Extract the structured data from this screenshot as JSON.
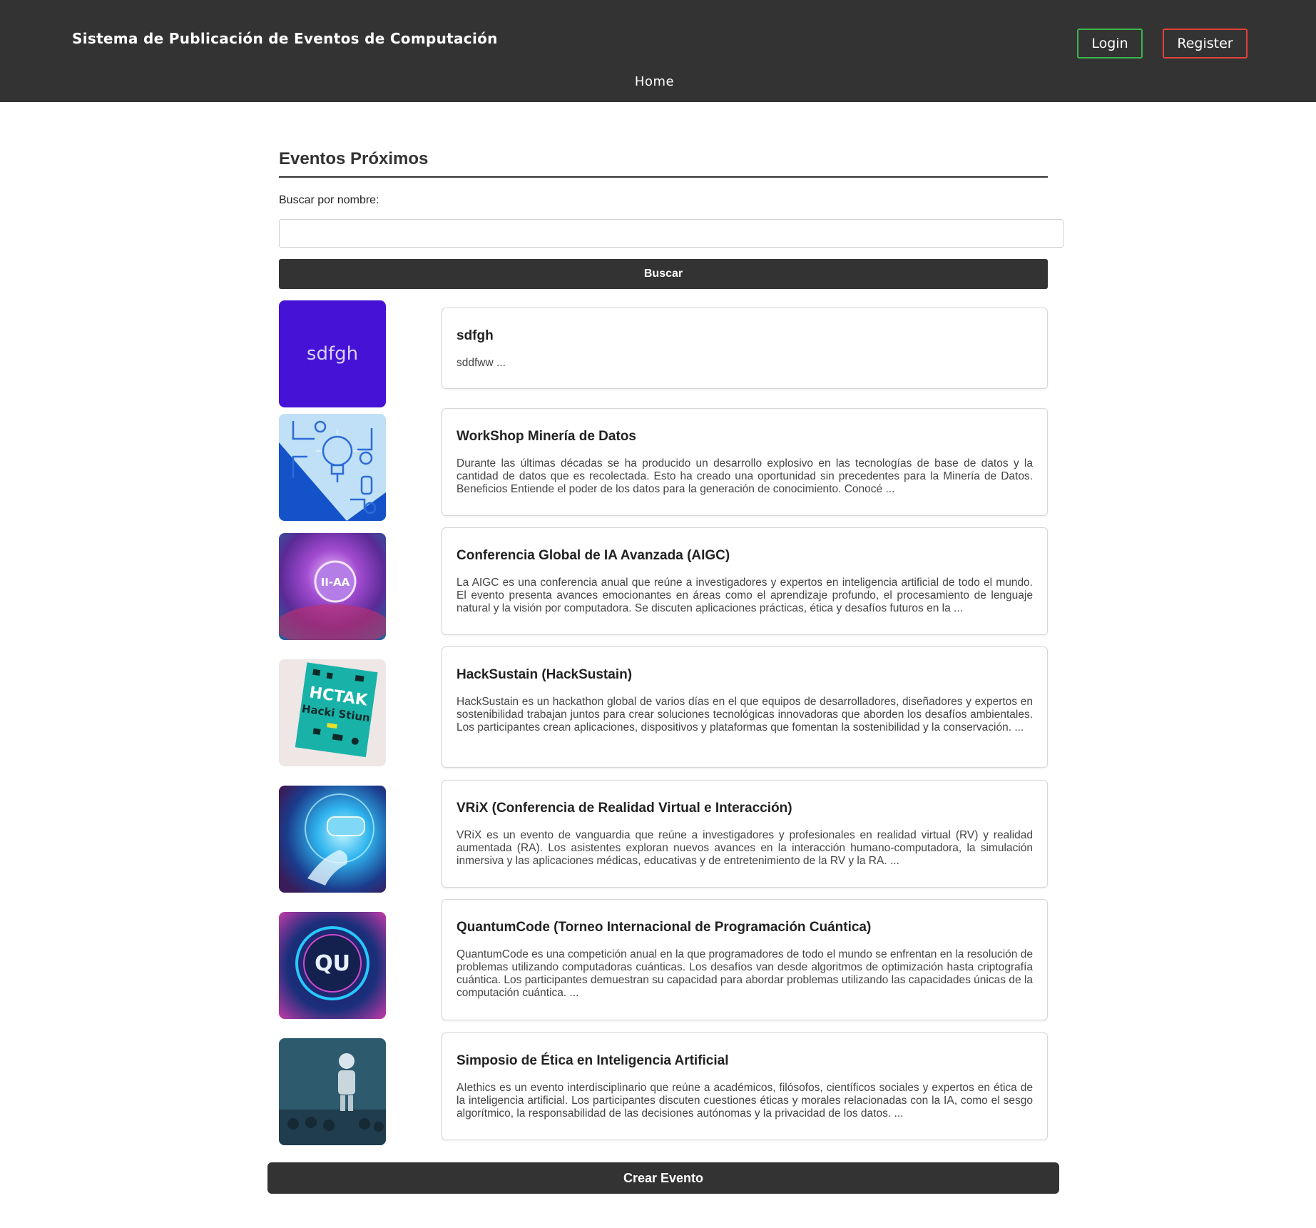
{
  "header": {
    "brand": "Sistema de Publicación de Eventos de Computación",
    "login_label": "Login",
    "register_label": "Register",
    "nav_home": "Home",
    "login_color": "#3bb54a",
    "register_color": "#e2423b",
    "background": "#333333"
  },
  "main": {
    "section_title": "Eventos Próximos",
    "search_label": "Buscar por nombre:",
    "search_value": "",
    "search_button": "Buscar",
    "create_button": "Crear Evento"
  },
  "events": [
    {
      "title": "sdfgh",
      "description": "sddfww ...",
      "image_text": "sdfgh"
    },
    {
      "title": "WorkShop Minería de Datos",
      "description": "Durante las últimas décadas se ha producido un desarrollo explosivo en las tecnologías de base de datos y la cantidad de datos que es recolectada. Esto ha creado una oportunidad sin precedentes para la Minería de Datos. Beneficios Entiende el poder de los datos para la generación de conocimiento. Conocé ..."
    },
    {
      "title": "Conferencia Global de IA Avanzada (AIGC)",
      "description": "La AIGC es una conferencia anual que reúne a investigadores y expertos en inteligencia artificial de todo el mundo. El evento presenta avances emocionantes en áreas como el aprendizaje profundo, el procesamiento de lenguaje natural y la visión por computadora. Se discuten aplicaciones prácticas, ética y desafíos futuros en la ...",
      "image_text": "II-AA"
    },
    {
      "title": "HackSustain (HackSustain)",
      "description": "HackSustain es un hackathon global de varios días en el que equipos de desarrolladores, diseñadores y expertos en sostenibilidad trabajan juntos para crear soluciones tecnológicas innovadoras que aborden los desafíos ambientales. Los participantes crean aplicaciones, dispositivos y plataformas que fomentan la sostenibilidad y la conservación. ...",
      "image_text": "HCTAK",
      "image_subtext": "Hacki Stiun"
    },
    {
      "title": "VRiX (Conferencia de Realidad Virtual e Interacción)",
      "description": "VRiX es un evento de vanguardia que reúne a investigadores y profesionales en realidad virtual (RV) y realidad aumentada (RA). Los asistentes exploran nuevos avances en la interacción humano-computadora, la simulación inmersiva y las aplicaciones médicas, educativas y de entretenimiento de la RV y la RA. ..."
    },
    {
      "title": "QuantumCode (Torneo Internacional de Programación Cuántica)",
      "description": "QuantumCode es una competición anual en la que programadores de todo el mundo se enfrentan en la resolución de problemas utilizando computadoras cuánticas. Los desafíos van desde algoritmos de optimización hasta criptografía cuántica. Los participantes demuestran su capacidad para abordar problemas utilizando las capacidades únicas de la computación cuántica. ...",
      "image_text": "QU"
    },
    {
      "title": "Simposio de Ética en Inteligencia Artificial",
      "description": "AIethics es un evento interdisciplinario que reúne a académicos, filósofos, científicos sociales y expertos en ética de la inteligencia artificial. Los participantes discuten cuestiones éticas y morales relacionadas con la IA, como el sesgo algorítmico, la responsabilidad de las decisiones autónomas y la privacidad de los datos. ..."
    }
  ]
}
